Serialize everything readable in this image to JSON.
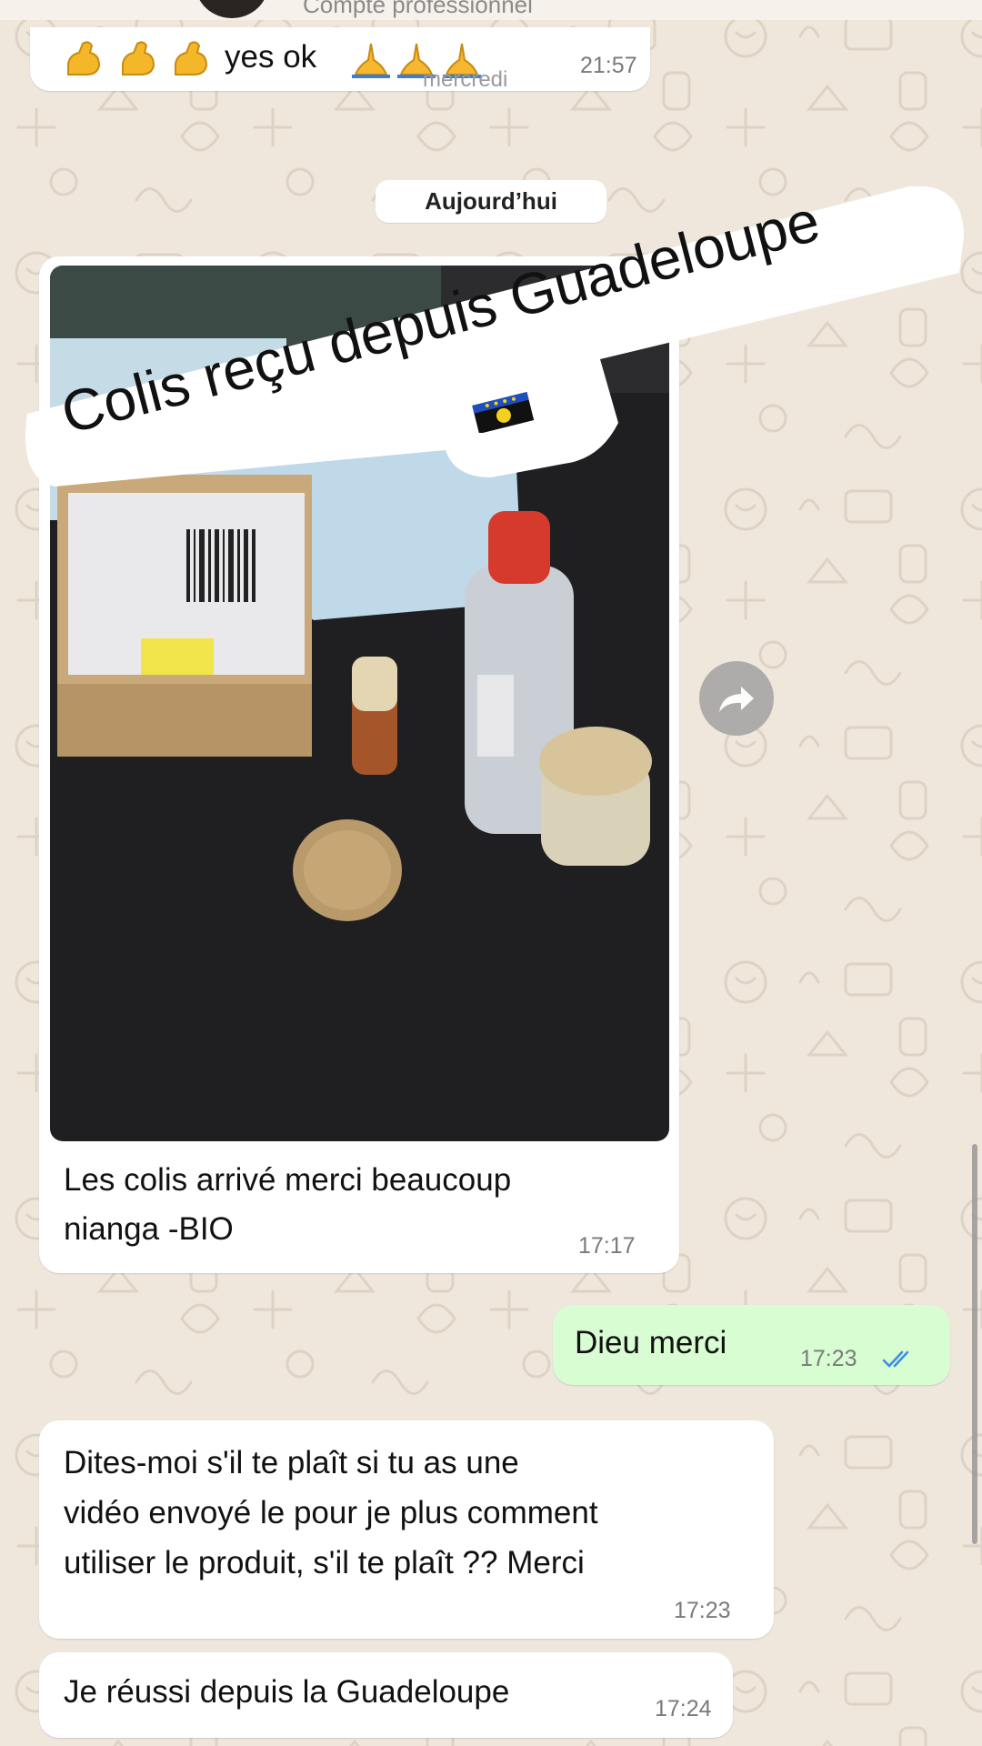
{
  "header": {
    "subtitle": "Compte professionnel"
  },
  "messages": {
    "m1": {
      "text": "yes ok",
      "time": "21:57",
      "day_overlay": "mercredi",
      "emoji_left": "flexed-biceps-emoji",
      "emoji_right": "folded-hands-emoji"
    },
    "date_chip": "Aujourd’hui",
    "m2": {
      "sticker_line1": "Colis reçu depuis Guadeloupe",
      "sticker_flag": "guadeloupe-flag-emoji",
      "caption_line1": "Les colis arrivé merci beaucoup",
      "caption_line2": "nianga -BIO",
      "time": "17:17"
    },
    "m3": {
      "text": "Dieu merci",
      "time": "17:23",
      "status": "read-double-check"
    },
    "m4": {
      "line1": "Dites-moi s'il te plaît si tu as une",
      "line2": "vidéo envoyé le pour je plus comment",
      "line3": "utiliser le produit, s'il te plaît ?? Merci",
      "time": "17:23"
    },
    "m5": {
      "text": "Je réussi depuis la Guadeloupe",
      "time": "17:24"
    }
  },
  "icons": {
    "forward": "forward-icon",
    "read_receipt": "double-check-icon"
  },
  "colors": {
    "wallpaper": "#efe7dc",
    "incoming_bubble": "#ffffff",
    "outgoing_bubble": "#d8fdd2",
    "read_receipt": "#3a8ee6"
  }
}
